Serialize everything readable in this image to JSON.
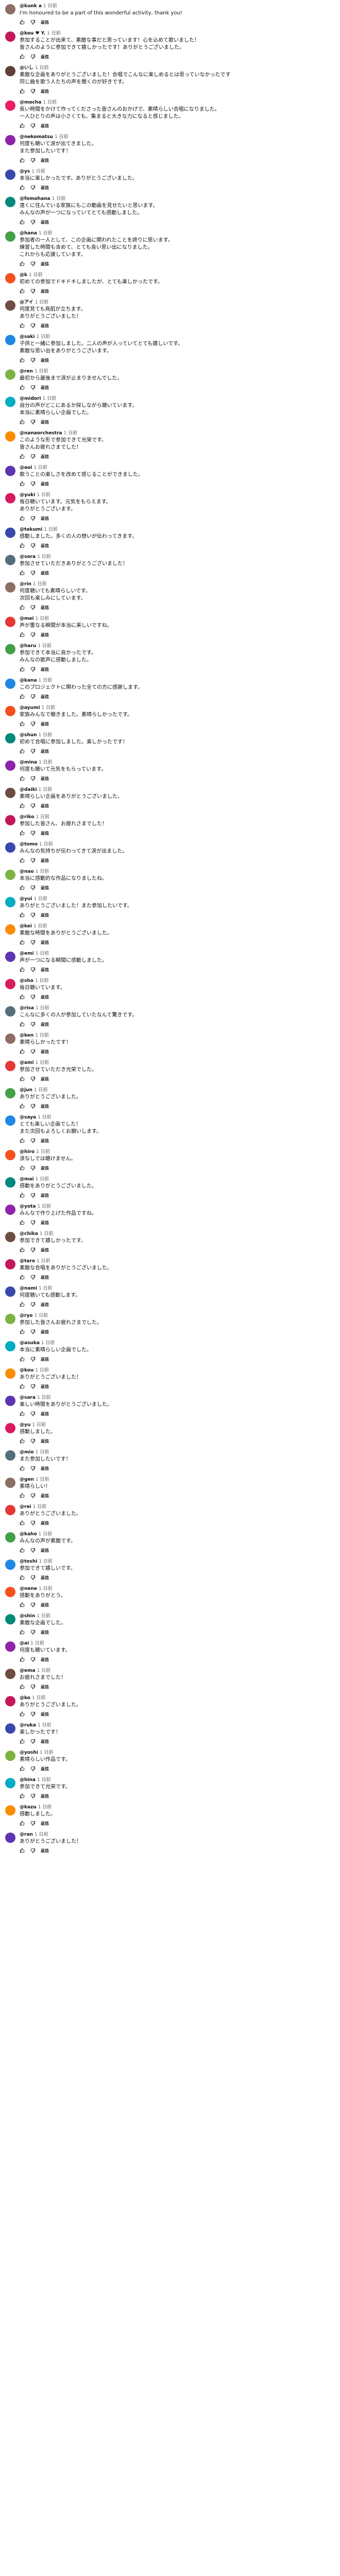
{
  "icons": {
    "like": "thumbs-up-icon",
    "dislike": "thumbs-down-icon"
  },
  "reply_label": "返信",
  "comments": [
    {
      "author": "@kunk a",
      "date": "1 日前",
      "avatar_color": "#8d6e63",
      "lines": [
        "I'm honoured to be a part of this wonderful activity, thank you!"
      ],
      "likes": ""
    },
    {
      "author": "@kou ♥ Y.",
      "date": "1 日前",
      "avatar_color": "#c2185b",
      "lines": [
        "参加することが出来て、素敵な事だと思っています！心を込めて歌いました！",
        "皆さんのように参加できて嬉しかったです！ありがとうございました。"
      ],
      "likes": ""
    },
    {
      "author": "@いし",
      "date": "1 日前",
      "avatar_color": "#5d4037",
      "lines": [
        "素敵な企画をありがとうございました！合唱でこんなに楽しめるとは思っていなかったです",
        "同じ曲を歌う人たちの声を聞くのが好きです。"
      ],
      "likes": ""
    },
    {
      "author": "@mocha",
      "date": "1 日前",
      "avatar_color": "#e91e63",
      "lines": [
        "長い時間をかけて作ってくださった皆さんのおかげで、素晴らしい合唱になりました。",
        "一人ひとりの声は小さくても、集まると大きな力になると感じました。"
      ],
      "likes": ""
    },
    {
      "author": "@nekomatsu",
      "date": "1 日前",
      "avatar_color": "#8e24aa",
      "lines": [
        "何度も聴いて涙が出てきました。",
        "また参加したいです！"
      ],
      "likes": ""
    },
    {
      "author": "@ys",
      "date": "1 日前",
      "avatar_color": "#3949ab",
      "lines": [
        "本当に楽しかったです。ありがとうございました。"
      ],
      "likes": ""
    },
    {
      "author": "@fomohana",
      "date": "1 日前",
      "avatar_color": "#00897b",
      "lines": [
        "遠くに住んでいる家族にもこの動画を見せたいと思います。",
        "みんなの声が一つになっていてとても感動しました。"
      ],
      "likes": ""
    },
    {
      "author": "@hana",
      "date": "1 日前",
      "avatar_color": "#43a047",
      "lines": [
        "参加者の一人として、この企画に関われたことを誇りに思います。",
        "練習した時間も含めて、とても良い思い出になりました。",
        "これからも応援しています。"
      ],
      "likes": ""
    },
    {
      "author": "@k",
      "date": "1 日前",
      "avatar_color": "#f4511e",
      "lines": [
        "初めての参加でドキドキしましたが、とても楽しかったです。"
      ],
      "likes": ""
    },
    {
      "author": "@アイ",
      "date": "1 日前",
      "avatar_color": "#6d4c41",
      "lines": [
        "何度見ても鳥肌が立ちます。",
        "ありがとうございました！"
      ],
      "likes": ""
    },
    {
      "author": "@saki",
      "date": "1 日前",
      "avatar_color": "#1e88e5",
      "lines": [
        "子供と一緒に参加しました。二人の声が入っていてとても嬉しいです。",
        "素敵な思い出をありがとうございます。"
      ],
      "likes": ""
    },
    {
      "author": "@ren",
      "date": "1 日前",
      "avatar_color": "#7cb342",
      "lines": [
        "最初から最後まで涙が止まりませんでした。"
      ],
      "likes": ""
    },
    {
      "author": "@midori",
      "date": "1 日前",
      "avatar_color": "#00acc1",
      "lines": [
        "自分の声がどこにあるか探しながら聴いています。",
        "本当に素晴らしい企画でした。"
      ],
      "likes": ""
    },
    {
      "author": "@nanaorchestra",
      "date": "1 日前",
      "avatar_color": "#fb8c00",
      "lines": [
        "このような形で参加できて光栄です。",
        "皆さんお疲れさまでした！"
      ],
      "likes": ""
    },
    {
      "author": "@aoi",
      "date": "1 日前",
      "avatar_color": "#5e35b1",
      "lines": [
        "歌うことの楽しさを改めて感じることができました。"
      ],
      "likes": ""
    },
    {
      "author": "@yuki",
      "date": "1 日前",
      "avatar_color": "#d81b60",
      "lines": [
        "毎日聴いています。元気をもらえます。",
        "ありがとうございます。"
      ],
      "likes": ""
    },
    {
      "author": "@takumi",
      "date": "1 日前",
      "avatar_color": "#3949ab",
      "lines": [
        "感動しました。多くの人の想いが伝わってきます。"
      ],
      "likes": ""
    },
    {
      "author": "@sora",
      "date": "1 日前",
      "avatar_color": "#546e7a",
      "lines": [
        "参加させていただきありがとうございました！"
      ],
      "likes": ""
    },
    {
      "author": "@rin",
      "date": "1 日前",
      "avatar_color": "#8d6e63",
      "lines": [
        "何度聴いても素晴らしいです。",
        "次回も楽しみにしています。"
      ],
      "likes": ""
    },
    {
      "author": "@mei",
      "date": "1 日前",
      "avatar_color": "#e53935",
      "lines": [
        "声が重なる瞬間が本当に美しいですね。"
      ],
      "likes": ""
    },
    {
      "author": "@haru",
      "date": "1 日前",
      "avatar_color": "#43a047",
      "lines": [
        "参加できて本当に良かったです。",
        "みんなの歌声に感動しました。"
      ],
      "likes": ""
    },
    {
      "author": "@kana",
      "date": "1 日前",
      "avatar_color": "#1e88e5",
      "lines": [
        "このプロジェクトに関わった全ての方に感謝します。"
      ],
      "likes": ""
    },
    {
      "author": "@ayumi",
      "date": "1 日前",
      "avatar_color": "#f4511e",
      "lines": [
        "家族みんなで聴きました。素晴らしかったです。"
      ],
      "likes": ""
    },
    {
      "author": "@shun",
      "date": "1 日前",
      "avatar_color": "#00897b",
      "lines": [
        "初めて合唱に参加しました。楽しかったです！"
      ],
      "likes": ""
    },
    {
      "author": "@mina",
      "date": "1 日前",
      "avatar_color": "#8e24aa",
      "lines": [
        "何度も聴いて元気をもらっています。"
      ],
      "likes": ""
    },
    {
      "author": "@daiki",
      "date": "1 日前",
      "avatar_color": "#6d4c41",
      "lines": [
        "素晴らしい企画をありがとうございました。"
      ],
      "likes": ""
    },
    {
      "author": "@riko",
      "date": "1 日前",
      "avatar_color": "#c2185b",
      "lines": [
        "参加した皆さん、お疲れさまでした！"
      ],
      "likes": ""
    },
    {
      "author": "@tomo",
      "date": "1 日前",
      "avatar_color": "#3949ab",
      "lines": [
        "みんなの気持ちが伝わってきて涙が出ました。"
      ],
      "likes": ""
    },
    {
      "author": "@nao",
      "date": "1 日前",
      "avatar_color": "#7cb342",
      "lines": [
        "本当に感動的な作品になりましたね。"
      ],
      "likes": ""
    },
    {
      "author": "@yui",
      "date": "1 日前",
      "avatar_color": "#00acc1",
      "lines": [
        "ありがとうございました！また参加したいです。"
      ],
      "likes": ""
    },
    {
      "author": "@kei",
      "date": "1 日前",
      "avatar_color": "#fb8c00",
      "lines": [
        "素敵な時間をありがとうございました。"
      ],
      "likes": ""
    },
    {
      "author": "@emi",
      "date": "1 日前",
      "avatar_color": "#5e35b1",
      "lines": [
        "声が一つになる瞬間に感動しました。"
      ],
      "likes": ""
    },
    {
      "author": "@sho",
      "date": "1 日前",
      "avatar_color": "#d81b60",
      "lines": [
        "毎日聴いています。"
      ],
      "likes": ""
    },
    {
      "author": "@risa",
      "date": "1 日前",
      "avatar_color": "#546e7a",
      "lines": [
        "こんなに多くの人が参加していたなんて驚きです。"
      ],
      "likes": ""
    },
    {
      "author": "@ken",
      "date": "1 日前",
      "avatar_color": "#8d6e63",
      "lines": [
        "素晴らしかったです！"
      ],
      "likes": ""
    },
    {
      "author": "@ami",
      "date": "1 日前",
      "avatar_color": "#e53935",
      "lines": [
        "参加させていただき光栄でした。"
      ],
      "likes": ""
    },
    {
      "author": "@jun",
      "date": "1 日前",
      "avatar_color": "#43a047",
      "lines": [
        "ありがとうございました。"
      ],
      "likes": ""
    },
    {
      "author": "@saya",
      "date": "1 日前",
      "avatar_color": "#1e88e5",
      "lines": [
        "とても楽しい企画でした！",
        "また次回もよろしくお願いします。"
      ],
      "likes": ""
    },
    {
      "author": "@hiro",
      "date": "1 日前",
      "avatar_color": "#f4511e",
      "lines": [
        "涙なしでは聴けません。"
      ],
      "likes": ""
    },
    {
      "author": "@mai",
      "date": "1 日前",
      "avatar_color": "#00897b",
      "lines": [
        "感動をありがとうございました。"
      ],
      "likes": ""
    },
    {
      "author": "@yota",
      "date": "1 日前",
      "avatar_color": "#8e24aa",
      "lines": [
        "みんなで作り上げた作品ですね。"
      ],
      "likes": ""
    },
    {
      "author": "@chika",
      "date": "1 日前",
      "avatar_color": "#6d4c41",
      "lines": [
        "参加できて嬉しかったです。"
      ],
      "likes": ""
    },
    {
      "author": "@taro",
      "date": "1 日前",
      "avatar_color": "#c2185b",
      "lines": [
        "素敵な合唱をありがとうございました。"
      ],
      "likes": ""
    },
    {
      "author": "@nami",
      "date": "1 日前",
      "avatar_color": "#3949ab",
      "lines": [
        "何度聴いても感動します。"
      ],
      "likes": ""
    },
    {
      "author": "@ryo",
      "date": "1 日前",
      "avatar_color": "#7cb342",
      "lines": [
        "参加した皆さんお疲れさまでした。"
      ],
      "likes": ""
    },
    {
      "author": "@asuka",
      "date": "1 日前",
      "avatar_color": "#00acc1",
      "lines": [
        "本当に素晴らしい企画でした。"
      ],
      "likes": ""
    },
    {
      "author": "@kou",
      "date": "1 日前",
      "avatar_color": "#fb8c00",
      "lines": [
        "ありがとうございました！"
      ],
      "likes": ""
    },
    {
      "author": "@sara",
      "date": "1 日前",
      "avatar_color": "#5e35b1",
      "lines": [
        "楽しい時間をありがとうございました。"
      ],
      "likes": ""
    },
    {
      "author": "@yu",
      "date": "1 日前",
      "avatar_color": "#d81b60",
      "lines": [
        "感動しました。"
      ],
      "likes": ""
    },
    {
      "author": "@mio",
      "date": "1 日前",
      "avatar_color": "#546e7a",
      "lines": [
        "また参加したいです！"
      ],
      "likes": ""
    },
    {
      "author": "@gen",
      "date": "1 日前",
      "avatar_color": "#8d6e63",
      "lines": [
        "素晴らしい！"
      ],
      "likes": ""
    },
    {
      "author": "@rei",
      "date": "1 日前",
      "avatar_color": "#e53935",
      "lines": [
        "ありがとうございました。"
      ],
      "likes": ""
    },
    {
      "author": "@kaho",
      "date": "1 日前",
      "avatar_color": "#43a047",
      "lines": [
        "みんなの声が素敵です。"
      ],
      "likes": ""
    },
    {
      "author": "@toshi",
      "date": "1 日前",
      "avatar_color": "#1e88e5",
      "lines": [
        "参加できて嬉しいです。"
      ],
      "likes": ""
    },
    {
      "author": "@nene",
      "date": "1 日前",
      "avatar_color": "#f4511e",
      "lines": [
        "感動をありがとう。"
      ],
      "likes": ""
    },
    {
      "author": "@shin",
      "date": "1 日前",
      "avatar_color": "#00897b",
      "lines": [
        "素敵な企画でした。"
      ],
      "likes": ""
    },
    {
      "author": "@ai",
      "date": "1 日前",
      "avatar_color": "#8e24aa",
      "lines": [
        "何度も聴いています。"
      ],
      "likes": ""
    },
    {
      "author": "@ema",
      "date": "1 日前",
      "avatar_color": "#6d4c41",
      "lines": [
        "お疲れさまでした！"
      ],
      "likes": ""
    },
    {
      "author": "@ko",
      "date": "1 日前",
      "avatar_color": "#c2185b",
      "lines": [
        "ありがとうございました。"
      ],
      "likes": ""
    },
    {
      "author": "@ruka",
      "date": "1 日前",
      "avatar_color": "#3949ab",
      "lines": [
        "楽しかったです！"
      ],
      "likes": ""
    },
    {
      "author": "@yoshi",
      "date": "1 日前",
      "avatar_color": "#7cb342",
      "lines": [
        "素晴らしい作品です。"
      ],
      "likes": ""
    },
    {
      "author": "@hina",
      "date": "1 日前",
      "avatar_color": "#00acc1",
      "lines": [
        "参加できて光栄です。"
      ],
      "likes": ""
    },
    {
      "author": "@kazu",
      "date": "1 日前",
      "avatar_color": "#fb8c00",
      "lines": [
        "感動しました。"
      ],
      "likes": ""
    },
    {
      "author": "@ran",
      "date": "1 日前",
      "avatar_color": "#5e35b1",
      "lines": [
        "ありがとうございました！"
      ],
      "likes": ""
    }
  ]
}
